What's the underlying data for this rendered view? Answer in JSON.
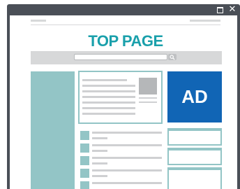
{
  "window": {
    "maximize_icon": "maximize-icon",
    "close_icon": "close-icon",
    "close_glyph": "✕"
  },
  "page": {
    "title": "TOP PAGE",
    "title_color": "#1aa0ab",
    "ad_label": "AD",
    "ad_color": "#1165b5",
    "accent_color": "#93c5c6"
  },
  "search": {
    "icon": "search-icon",
    "placeholder": ""
  }
}
